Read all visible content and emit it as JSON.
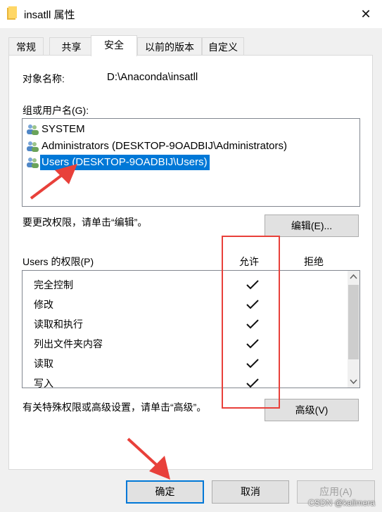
{
  "window": {
    "title": "insatll 属性",
    "close_label": "✕"
  },
  "tabs": [
    {
      "label": "常规"
    },
    {
      "label": "共享"
    },
    {
      "label": "安全"
    },
    {
      "label": "以前的版本"
    },
    {
      "label": "自定义"
    }
  ],
  "active_tab": "安全",
  "object": {
    "label": "对象名称:",
    "value": "D:\\Anaconda\\insatll"
  },
  "groups": {
    "label": "组或用户名(G):",
    "items": [
      {
        "name": "SYSTEM",
        "icon": "users-icon"
      },
      {
        "name": "Administrators (DESKTOP-9OADBIJ\\Administrators)",
        "icon": "users-icon"
      },
      {
        "name": "Users (DESKTOP-9OADBIJ\\Users)",
        "icon": "users-icon",
        "selected": true
      }
    ]
  },
  "edit": {
    "hint": "要更改权限，请单击“编辑”。",
    "button": "编辑(E)..."
  },
  "permissions": {
    "label": "Users 的权限(P)",
    "allow_header": "允许",
    "deny_header": "拒绝",
    "rows": [
      {
        "name": "完全控制",
        "allow": true,
        "deny": false
      },
      {
        "name": "修改",
        "allow": true,
        "deny": false
      },
      {
        "name": "读取和执行",
        "allow": true,
        "deny": false
      },
      {
        "name": "列出文件夹内容",
        "allow": true,
        "deny": false
      },
      {
        "name": "读取",
        "allow": true,
        "deny": false
      },
      {
        "name": "写入",
        "allow": true,
        "deny": false
      }
    ]
  },
  "advanced": {
    "hint": "有关特殊权限或高级设置，请单击“高级”。",
    "button": "高级(V)"
  },
  "footer": {
    "ok": "确定",
    "cancel": "取消",
    "apply": "应用(A)"
  },
  "watermark": "CSDN @kalimera",
  "colors": {
    "selection": "#0078d7",
    "annotation": "#e8403a"
  }
}
